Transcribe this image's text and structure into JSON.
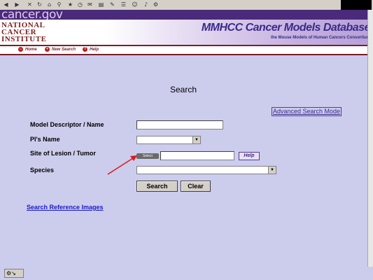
{
  "header": {
    "gov_logo": "cancer.gov",
    "nci_logo": "NATIONAL CANCER INSTITUTE",
    "title": "MMHCC  Cancer Models Database",
    "subtitle": "the Mouse Models of Human Cancers Consortium"
  },
  "nav": {
    "home": "Home",
    "new_search": "New Search",
    "help": "Help"
  },
  "main": {
    "title": "Search",
    "advanced_link": "Advanced Search Mode",
    "model_label": "Model Descriptor / Name",
    "pi_label": "PI's Name",
    "site_label": "Site of Lesion / Tumor",
    "species_label": "Species",
    "select_button": "Select",
    "help_button": "Help",
    "search_button": "Search",
    "clear_button": "Clear",
    "reference_link": "Search Reference Images"
  },
  "colors": {
    "background": "#cccced",
    "nav_border": "#7a1e2a",
    "link": "#1a1acc",
    "annotation_arrow": "#e01818"
  }
}
